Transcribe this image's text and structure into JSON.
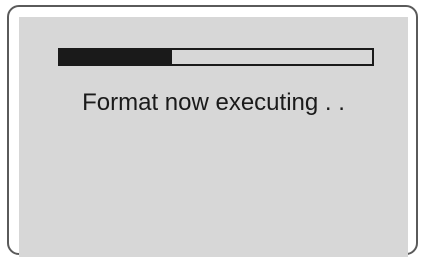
{
  "progress": {
    "fraction": 0.36
  },
  "status": {
    "message": "Format now executing . ."
  }
}
